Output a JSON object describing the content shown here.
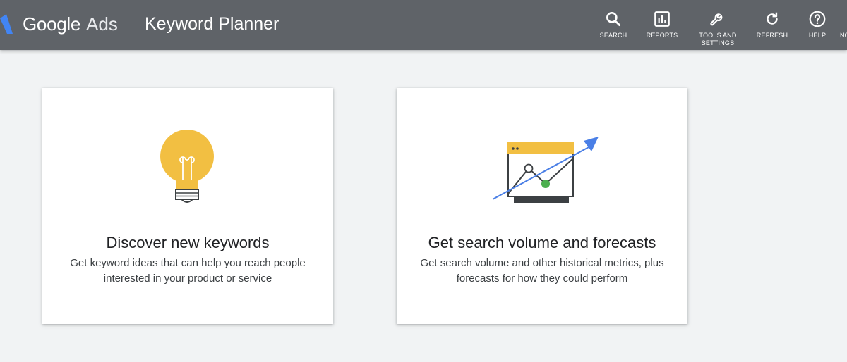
{
  "header": {
    "brand_google": "Google",
    "brand_ads": "Ads",
    "page_title": "Keyword Planner",
    "background_color": "#5f6368",
    "logo_icon": "google-ads-logo-icon"
  },
  "nav": [
    {
      "label": "SEARCH",
      "icon": "search-icon"
    },
    {
      "label": "REPORTS",
      "icon": "reports-icon"
    },
    {
      "label": "TOOLS AND\nSETTINGS",
      "icon": "wrench-icon"
    },
    {
      "label": "REFRESH",
      "icon": "refresh-icon"
    },
    {
      "label": "HELP",
      "icon": "help-icon"
    }
  ],
  "nav_overflow": "NO",
  "cards": [
    {
      "title": "Discover new keywords",
      "description": "Get keyword ideas that can help you reach people interested in your product or service",
      "icon": "lightbulb-icon"
    },
    {
      "title": "Get search volume and forecasts",
      "description": "Get search volume and other historical metrics, plus forecasts for how they could perform",
      "icon": "trend-chart-icon"
    }
  ],
  "colors": {
    "page_bg": "#f1f3f4",
    "bulb_yellow": "#f2bf42",
    "trend_blue": "#4a7fe6",
    "point_green": "#4caf50"
  }
}
